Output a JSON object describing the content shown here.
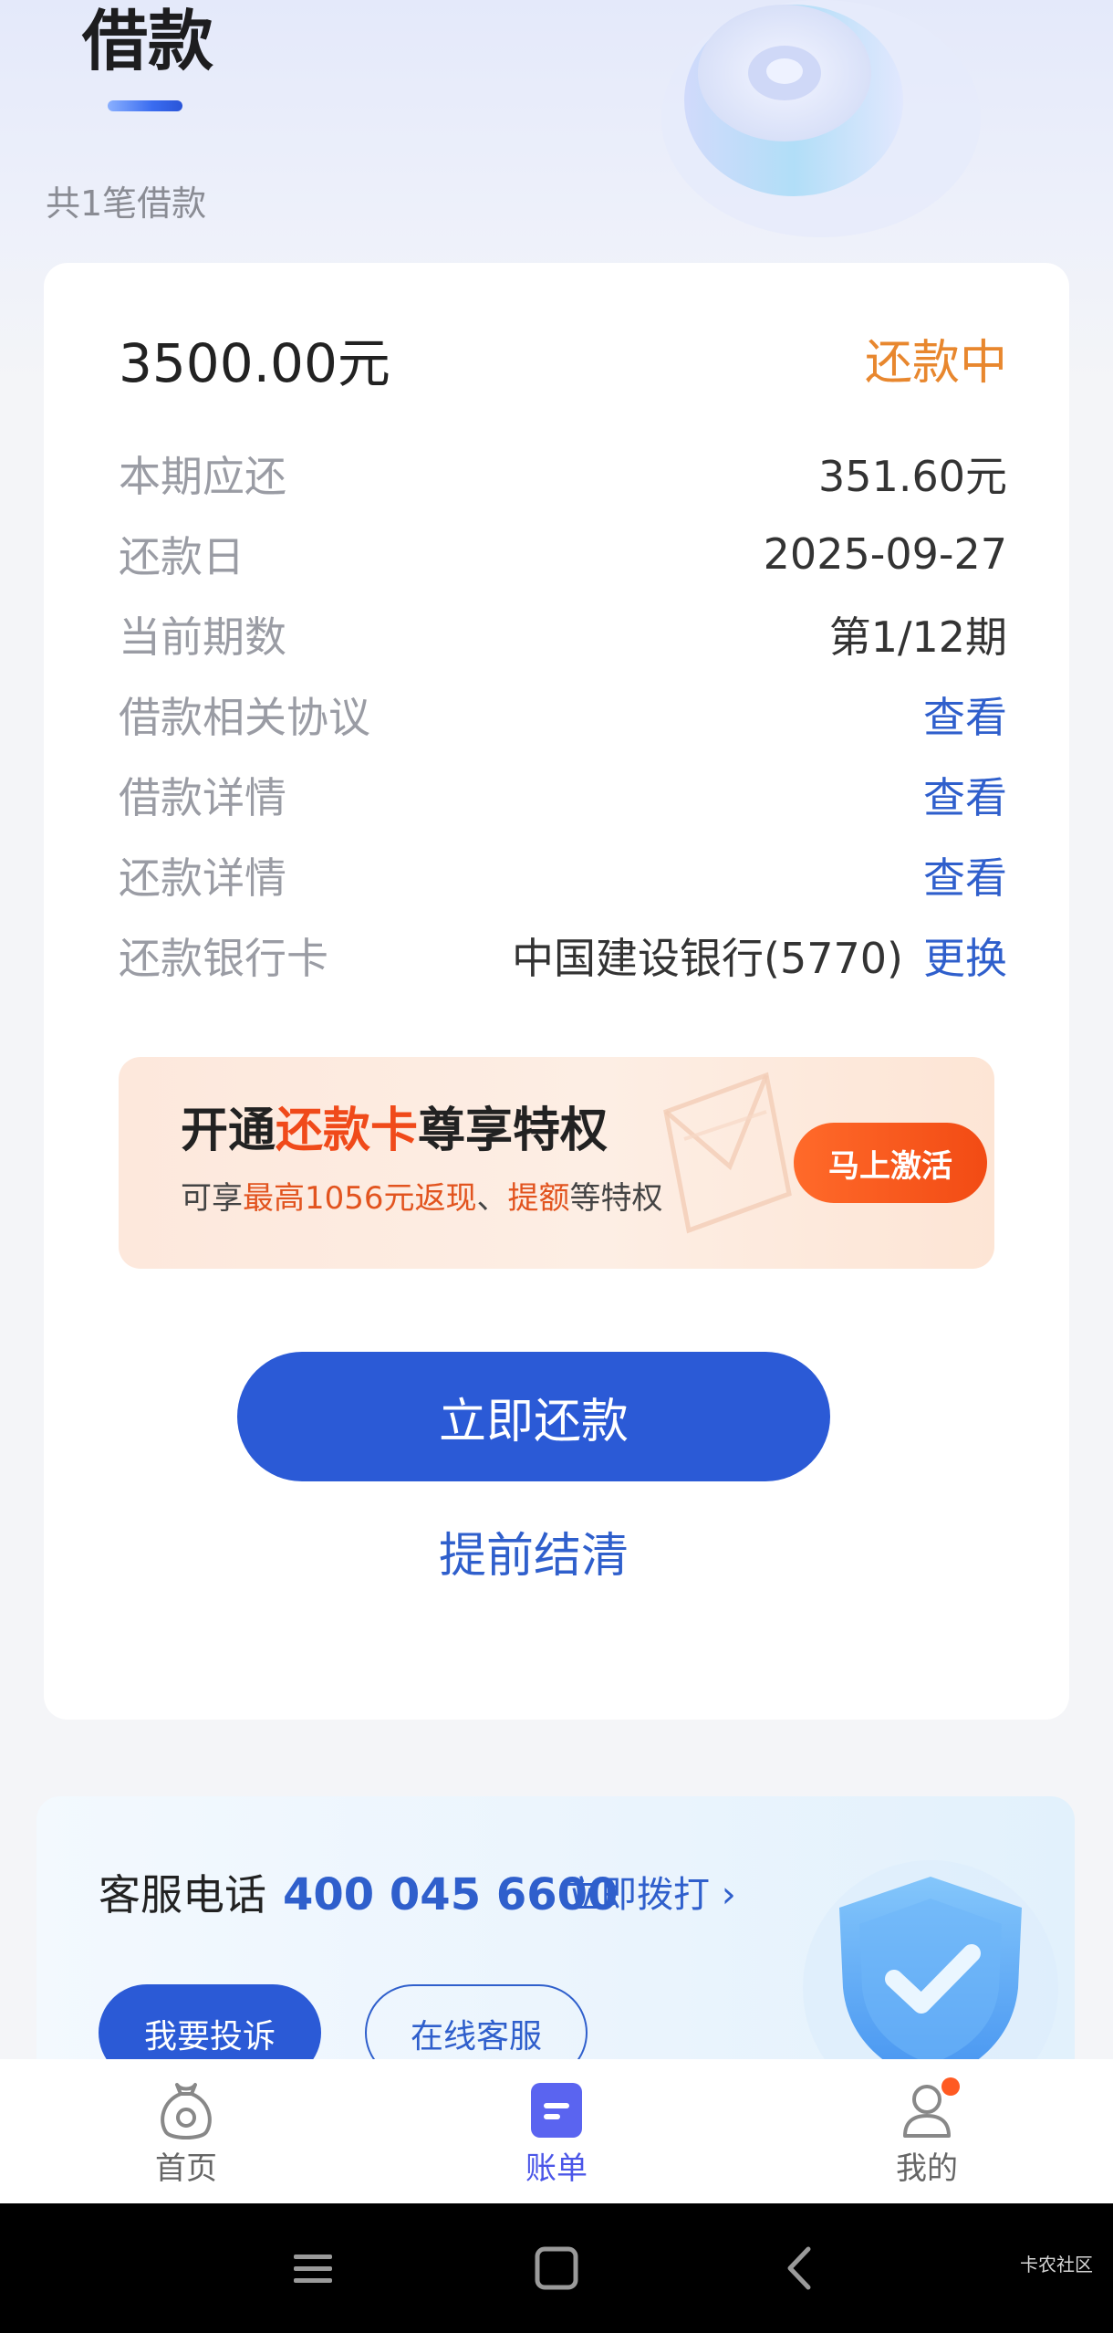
{
  "header": {
    "title": "借款",
    "loan_count": "共1笔借款"
  },
  "loan": {
    "amount": "3500.00元",
    "status": "还款中",
    "status_color": "#e8872e",
    "rows": [
      {
        "label": "本期应还",
        "value": "351.60元"
      },
      {
        "label": "还款日",
        "value": "2025-09-27"
      },
      {
        "label": "当前期数",
        "value": "第1/12期"
      },
      {
        "label": "借款相关协议",
        "link": "查看"
      },
      {
        "label": "借款详情",
        "link": "查看"
      },
      {
        "label": "还款详情",
        "link": "查看"
      },
      {
        "label": "还款银行卡",
        "value": "中国建设银行(5770)",
        "link": "更换"
      }
    ]
  },
  "promo": {
    "title_prefix": "开通",
    "title_highlight": "还款卡",
    "title_suffix": "尊享特权",
    "sub_prefix": "可享",
    "sub_highlight_1": "最高1056元返现",
    "sub_sep": "、",
    "sub_highlight_2": "提额",
    "sub_suffix": "等特权",
    "button": "马上激活"
  },
  "actions": {
    "repay_button": "立即还款",
    "settle_link": "提前结清"
  },
  "service": {
    "label": "客服电话",
    "phone": "400 045 6600",
    "call_link": "立即拨打 ›",
    "complain_button": "我要投诉",
    "online_button": "在线客服"
  },
  "tabbar": {
    "items": [
      {
        "label": "首页",
        "icon": "money-bag-icon",
        "active": false
      },
      {
        "label": "账单",
        "icon": "bill-icon",
        "active": true
      },
      {
        "label": "我的",
        "icon": "profile-icon",
        "active": false,
        "badge": true
      }
    ]
  },
  "system_nav": {
    "icons": [
      "menu-icon",
      "home-square-icon",
      "back-icon"
    ]
  },
  "watermark": "卡农社区",
  "colors": {
    "accent_blue": "#2b5ad6",
    "link_blue": "#2f5fcc",
    "promo_orange": "#f04a1a",
    "tab_active": "#4b56e8"
  }
}
